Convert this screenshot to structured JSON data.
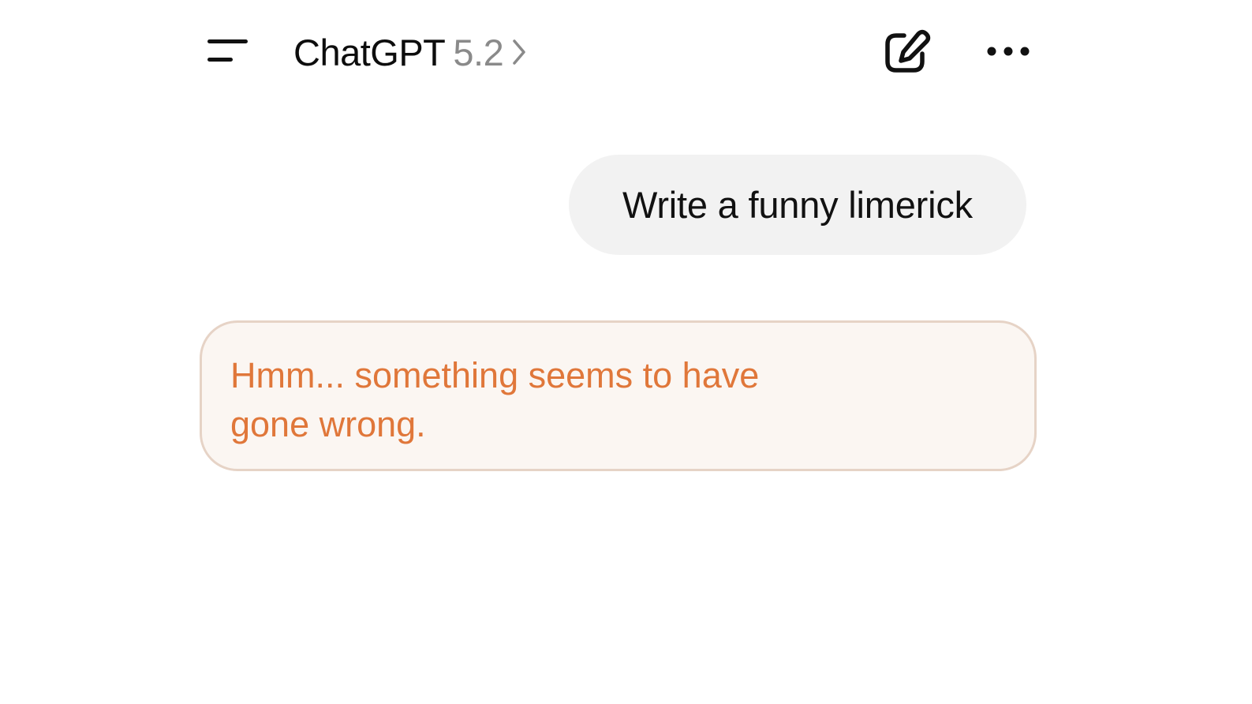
{
  "header": {
    "title": "ChatGPT",
    "model_version": "5.2",
    "menu_icon": "hamburger-menu-icon",
    "chevron_icon": "chevron-right-icon",
    "new_chat_icon": "pencil-square-icon",
    "more_icon": "ellipsis-horizontal-icon"
  },
  "conversation": {
    "user_message": "Write a funny limerick",
    "error_message": "Hmm... something seems to have gone wrong."
  },
  "colors": {
    "user_bubble_bg": "#f2f2f2",
    "error_text": "#e0773a",
    "error_bg": "#fbf6f2",
    "error_border": "#e6d3c6"
  }
}
